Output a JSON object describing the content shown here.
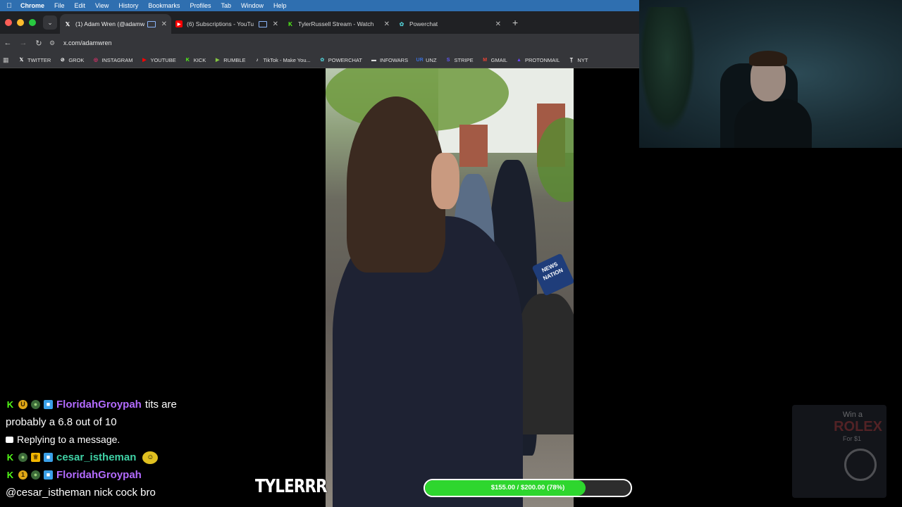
{
  "menubar": {
    "items": [
      "Chrome",
      "File",
      "Edit",
      "View",
      "History",
      "Bookmarks",
      "Profiles",
      "Tab",
      "Window",
      "Help"
    ]
  },
  "tabs": [
    {
      "title": "(1) Adam Wren (@adamw",
      "icon": "x-icon",
      "active": true
    },
    {
      "title": "(6) Subscriptions - YouTu",
      "icon": "youtube-icon",
      "active": false
    },
    {
      "title": "TylerRussell Stream - Watch",
      "icon": "kick-icon",
      "active": false
    },
    {
      "title": "Powerchat",
      "icon": "powerchat-icon",
      "active": false
    }
  ],
  "address": {
    "url": "x.com/adamwren"
  },
  "bookmarks": [
    {
      "label": "TWITTER",
      "icon": "x-icon",
      "color": "#ffffff"
    },
    {
      "label": "GROK",
      "icon": "grok-icon",
      "color": "#ffffff"
    },
    {
      "label": "INSTAGRAM",
      "icon": "instagram-icon",
      "color": "#e1306c"
    },
    {
      "label": "YOUTUBE",
      "icon": "youtube-icon",
      "color": "#ff0000"
    },
    {
      "label": "KICK",
      "icon": "kick-icon",
      "color": "#53fc18"
    },
    {
      "label": "RUMBLE",
      "icon": "rumble-icon",
      "color": "#85c742"
    },
    {
      "label": "TikTok - Make You...",
      "icon": "tiktok-icon",
      "color": "#ffffff"
    },
    {
      "label": "POWERCHAT",
      "icon": "powerchat-icon",
      "color": "#4fc3c9"
    },
    {
      "label": "INFOWARS",
      "icon": "infowars-icon",
      "color": "#dddddd"
    },
    {
      "label": "UNZ",
      "icon": "unz-icon",
      "color": "#3a6fd8"
    },
    {
      "label": "STRIPE",
      "icon": "stripe-icon",
      "color": "#635bff"
    },
    {
      "label": "GMAIL",
      "icon": "gmail-icon",
      "color": "#ea4335"
    },
    {
      "label": "PROTONMAIL",
      "icon": "protonmail-icon",
      "color": "#6d4aff"
    },
    {
      "label": "NYT",
      "icon": "nyt-icon",
      "color": "#ffffff"
    }
  ],
  "video": {
    "mic_flag": "NEWS NATION"
  },
  "chat": {
    "messages": [
      {
        "username": "FloridahGroypah",
        "username_color": "#b36bff",
        "badges": [
          "kick",
          "gold",
          "frog",
          "cube"
        ],
        "text": "tits are"
      },
      {
        "continuation": "probably a 6.8 out of 10"
      },
      {
        "reply_note": "Replying to a message."
      },
      {
        "username": "cesar_istheman",
        "username_color": "#3fd1a5",
        "badges": [
          "kick",
          "frog",
          "crown",
          "cube"
        ],
        "emote": true
      },
      {
        "username": "FloridahGroypah",
        "username_color": "#b36bff",
        "badges": [
          "kick",
          "gold",
          "frog",
          "cube"
        ]
      },
      {
        "continuation": "@cesar_istheman nick cock bro"
      }
    ]
  },
  "overlay": {
    "brand": "TYLERRR"
  },
  "goal": {
    "label": "$155.00 / $200.00 (78%)",
    "progress": 0.78,
    "fill_color": "#2ed62e"
  },
  "ad": {
    "line1": "Win a",
    "line2": "ROLEX",
    "line3": "For $1"
  }
}
